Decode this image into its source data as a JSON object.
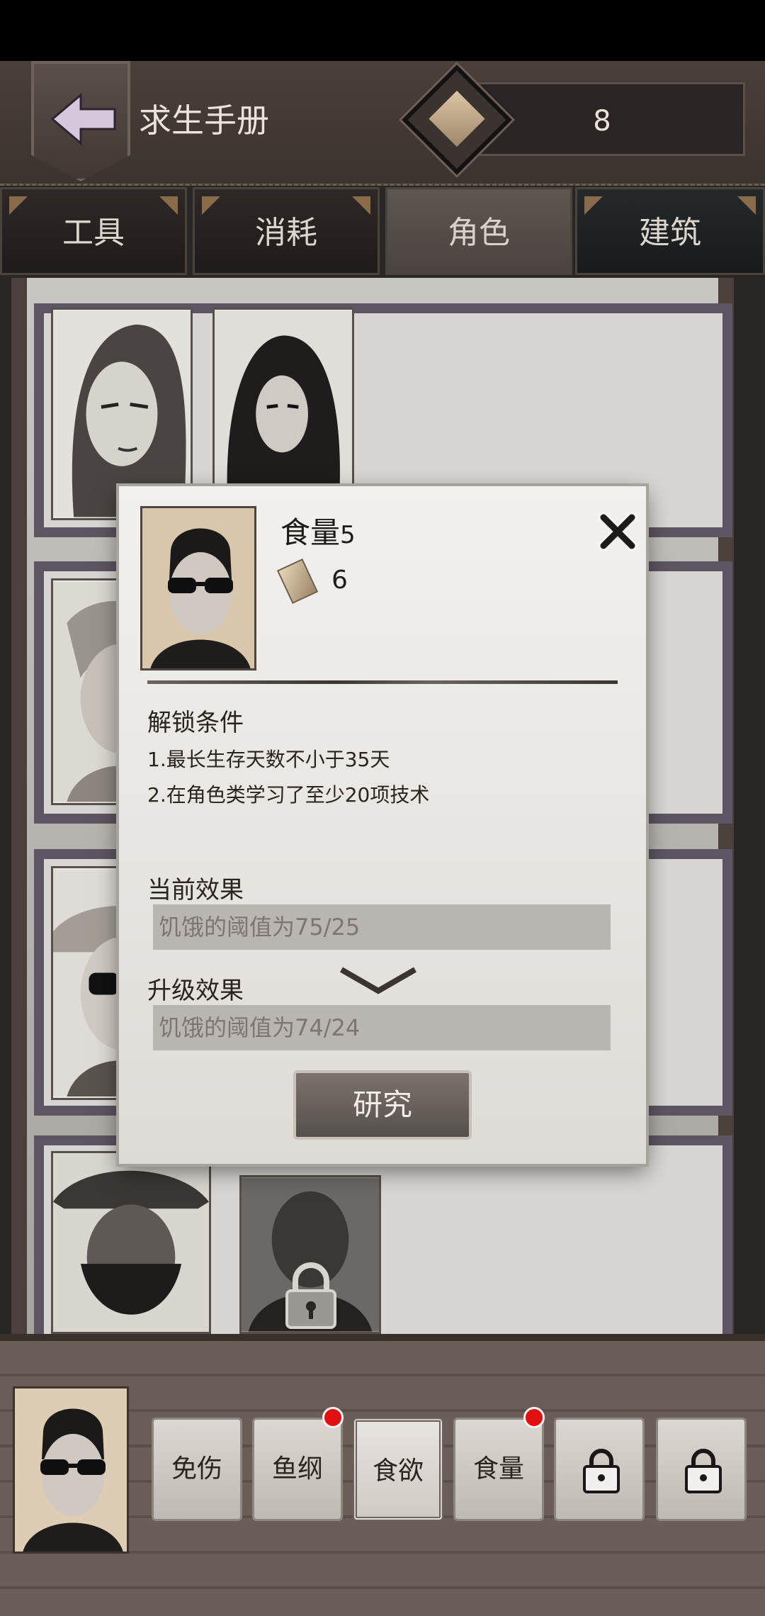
{
  "header": {
    "title": "求生手册",
    "currency_value": "8"
  },
  "tabs": [
    {
      "label": "工具"
    },
    {
      "label": "消耗"
    },
    {
      "label": "角色",
      "active": true
    },
    {
      "label": "建筑"
    }
  ],
  "modal": {
    "skill_name": "食量",
    "skill_level": "5",
    "cost": "6",
    "unlock_title": "解锁条件",
    "conditions": [
      "1.最长生存天数不小于35天",
      "2.在角色类学习了至少20项技术"
    ],
    "current_effect_title": "当前效果",
    "current_effect": "饥饿的阈值为75/25",
    "upgrade_effect_title": "升级效果",
    "upgrade_effect": "饥饿的阈值为74/24",
    "research_label": "研究"
  },
  "skills": [
    {
      "label": "免伤",
      "badge": false
    },
    {
      "label": "鱼纲",
      "badge": true
    },
    {
      "label": "食欲",
      "badge": false,
      "selected": true
    },
    {
      "label": "食量",
      "badge": true
    },
    {
      "label": "",
      "locked": true
    },
    {
      "label": "",
      "locked": true
    }
  ],
  "colors": {
    "accent_badge": "#e01010",
    "paper": "#f3f1ee",
    "frame": "#5d5561"
  }
}
